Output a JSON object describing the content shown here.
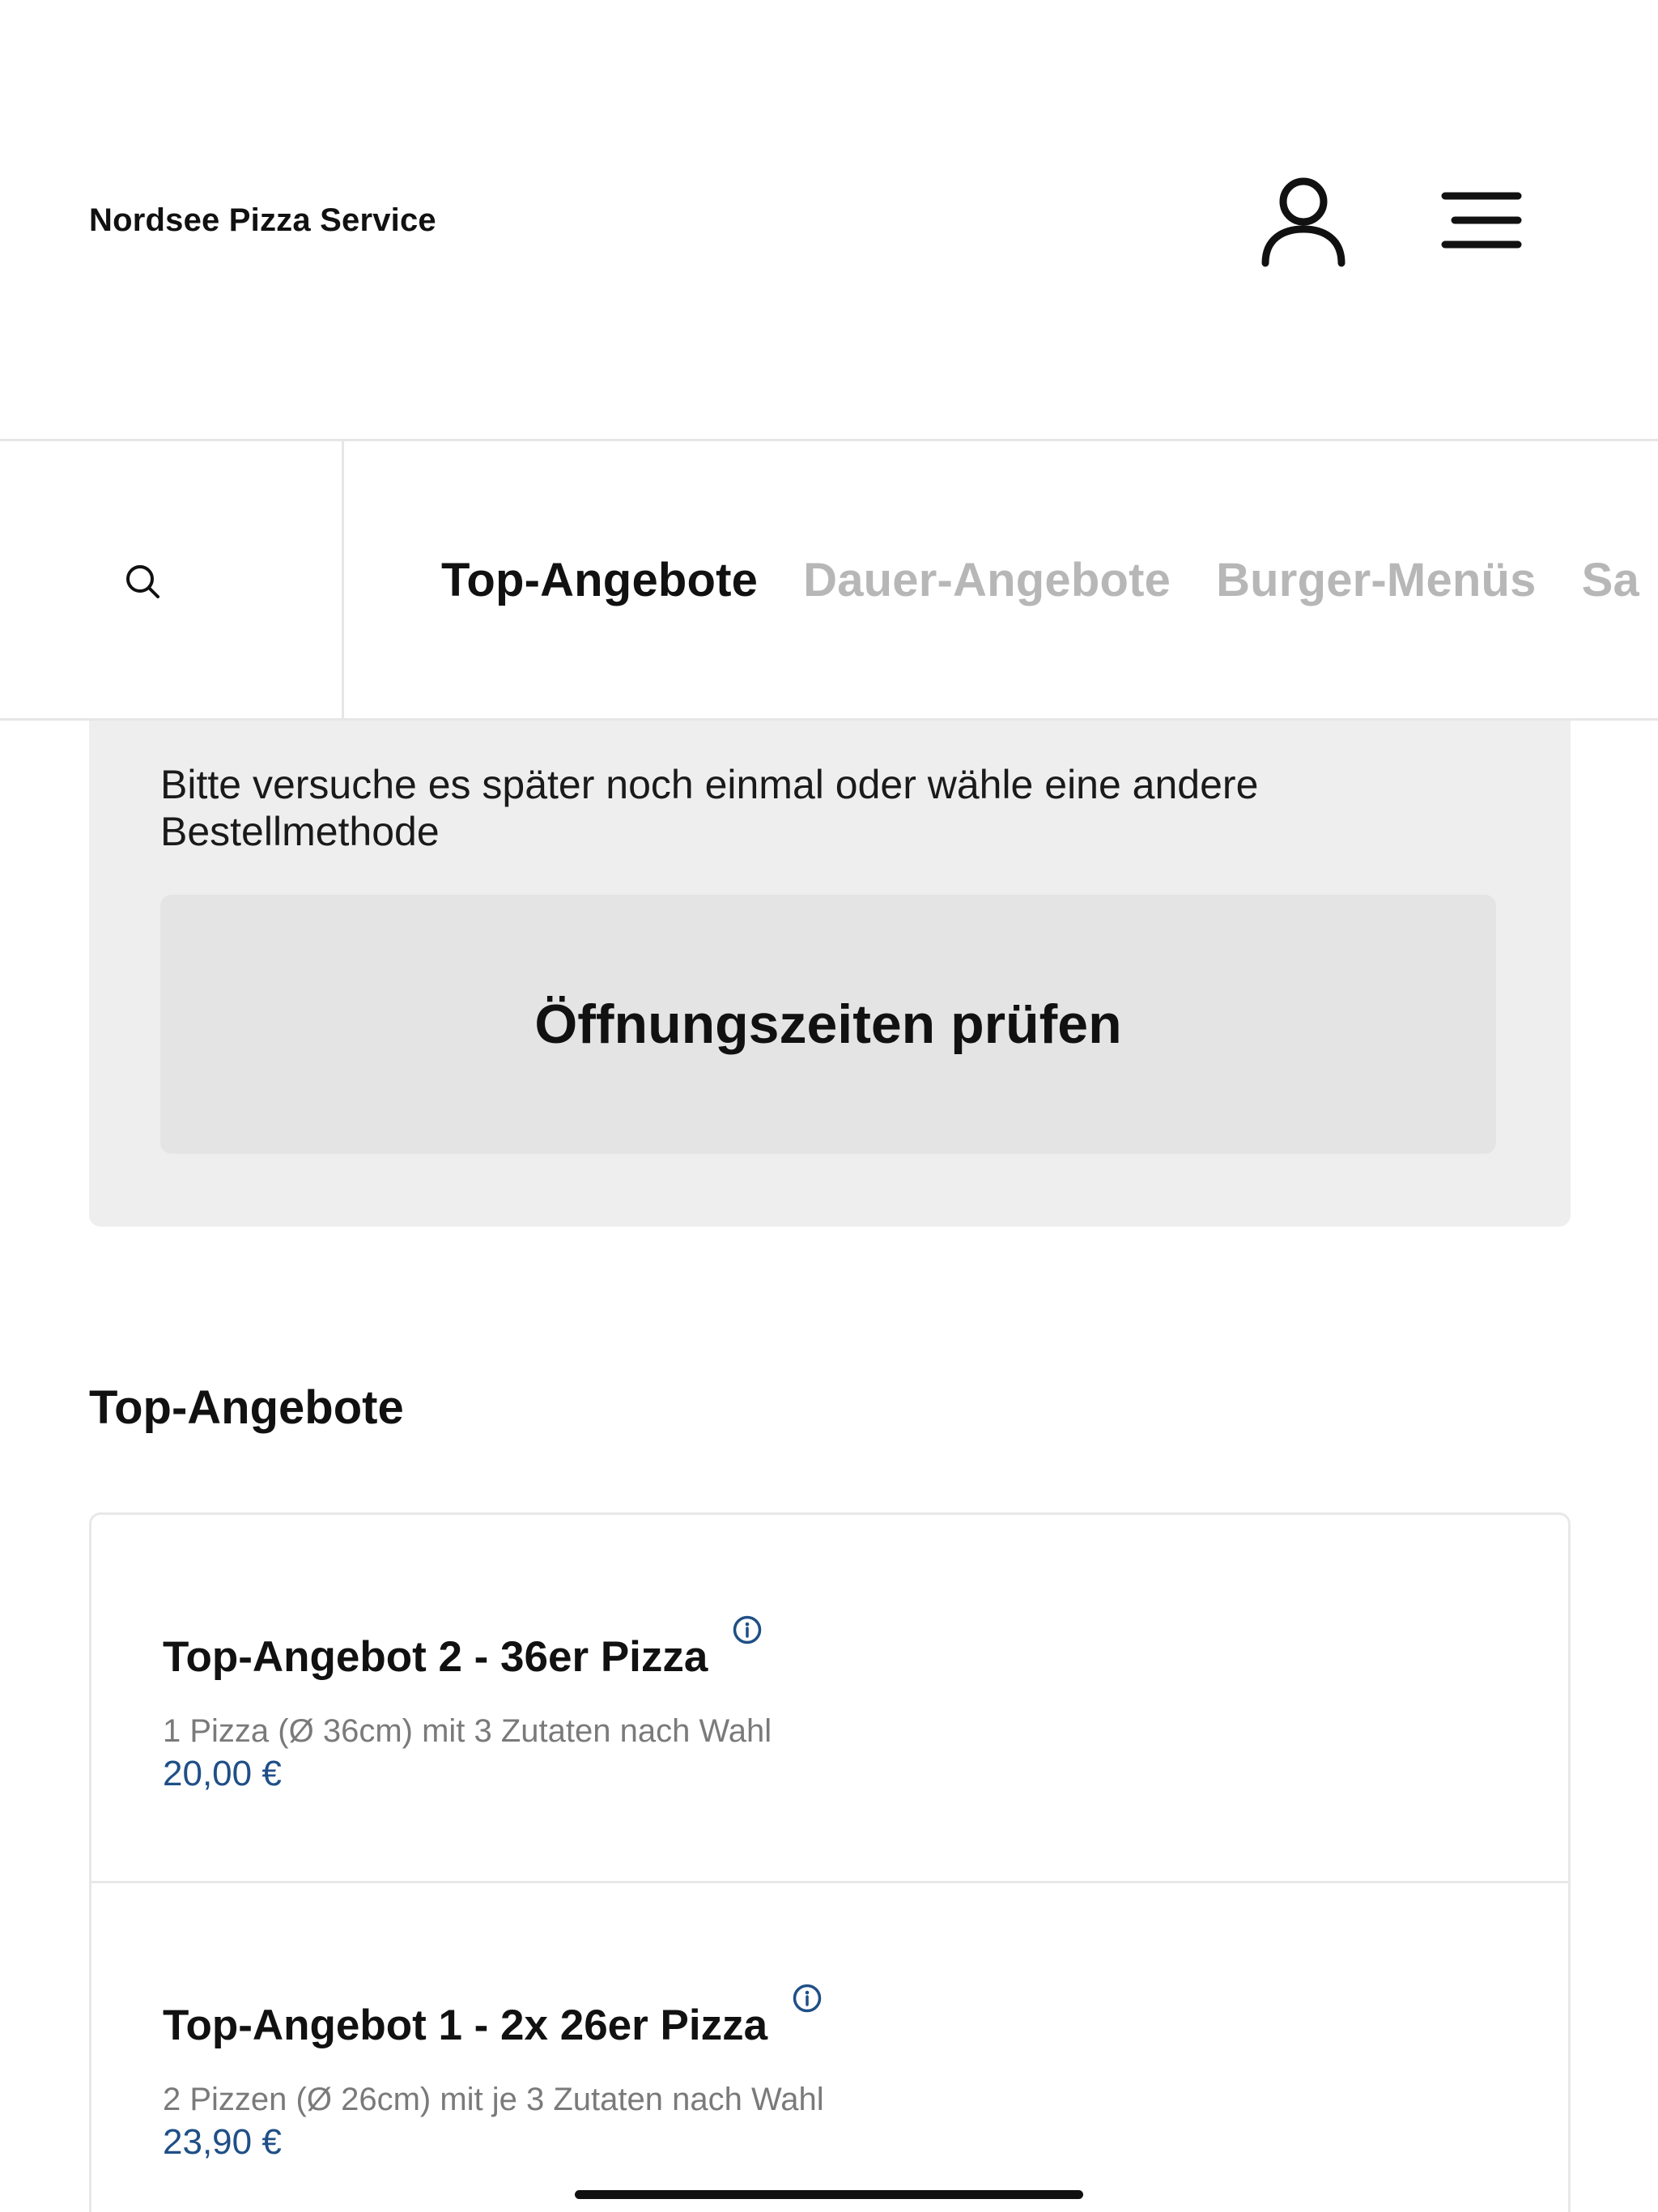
{
  "header": {
    "brand": "Nordsee Pizza Service",
    "account_icon": "user-icon",
    "menu_icon": "hamburger-menu-icon"
  },
  "nav": {
    "search_icon": "search-icon",
    "tabs": [
      {
        "label": "Top-Angebote",
        "active": true
      },
      {
        "label": "Dauer-Angebote",
        "active": false
      },
      {
        "label": "Burger-Menüs",
        "active": false
      },
      {
        "label": "Sa",
        "active": false
      }
    ]
  },
  "notice": {
    "text": "Bitte versuche es später noch einmal oder wähle eine andere Bestellmethode",
    "button_label": "Öffnungszeiten prüfen"
  },
  "section": {
    "title": "Top-Angebote",
    "offers": [
      {
        "title": "Top-Angebot 2 - 36er Pizza",
        "description": "1 Pizza (Ø 36cm) mit 3 Zutaten nach Wahl",
        "price": "20,00 €"
      },
      {
        "title": "Top-Angebot 1 - 2x 26er Pizza",
        "description": "2 Pizzen (Ø 26cm) mit je 3 Zutaten nach Wahl",
        "price": "23,90 €"
      }
    ]
  },
  "colors": {
    "accent": "#1f4f86",
    "inactive_tab": "#b7b7b7",
    "notice_bg": "#eeeeee"
  }
}
